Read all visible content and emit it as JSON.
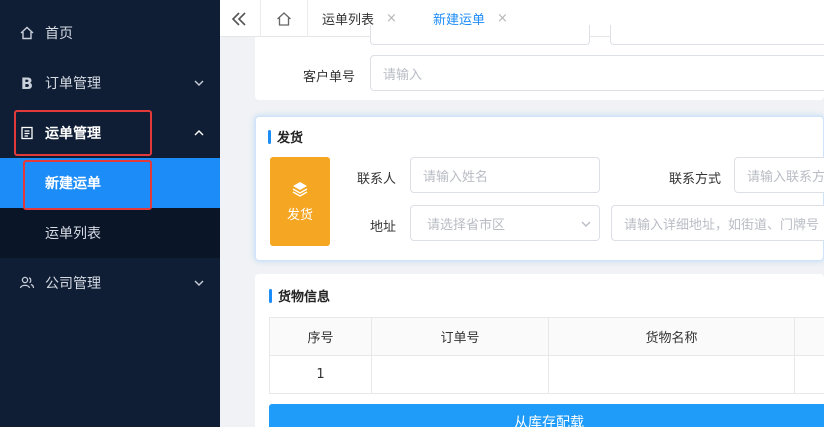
{
  "sidebar": {
    "items": [
      {
        "label": "首页",
        "icon": "home-icon"
      },
      {
        "label": "订单管理",
        "icon": "b-icon"
      },
      {
        "label": "运单管理",
        "icon": "document-icon"
      },
      {
        "label": "新建运单"
      },
      {
        "label": "运单列表"
      },
      {
        "label": "公司管理",
        "icon": "users-icon"
      }
    ],
    "b_glyph": "B"
  },
  "tabs": [
    {
      "label": "运单列表",
      "close": "×"
    },
    {
      "label": "新建运单",
      "close": "×"
    }
  ],
  "top_form": {
    "customer_no_label": "客户单号",
    "customer_no_placeholder": "请输入"
  },
  "shipper": {
    "title": "发货",
    "tile_label": "发货",
    "contact_label": "联系人",
    "contact_placeholder": "请输入姓名",
    "phone_label": "联系方式",
    "phone_placeholder": "请输入联系方",
    "address_label": "地址",
    "region_placeholder": "请选择省市区",
    "detail_placeholder": "请输入详细地址，如街道、门牌号"
  },
  "goods": {
    "title": "货物信息",
    "columns": [
      "序号",
      "订单号",
      "货物名称",
      ""
    ],
    "rows": [
      [
        "1",
        "",
        "",
        ""
      ]
    ],
    "button_label": "从库存配载"
  },
  "colors": {
    "accent": "#1c8cf8",
    "sidebar": "#0f1e35",
    "tile": "#f5a623",
    "highlight": "#e23a3a"
  }
}
